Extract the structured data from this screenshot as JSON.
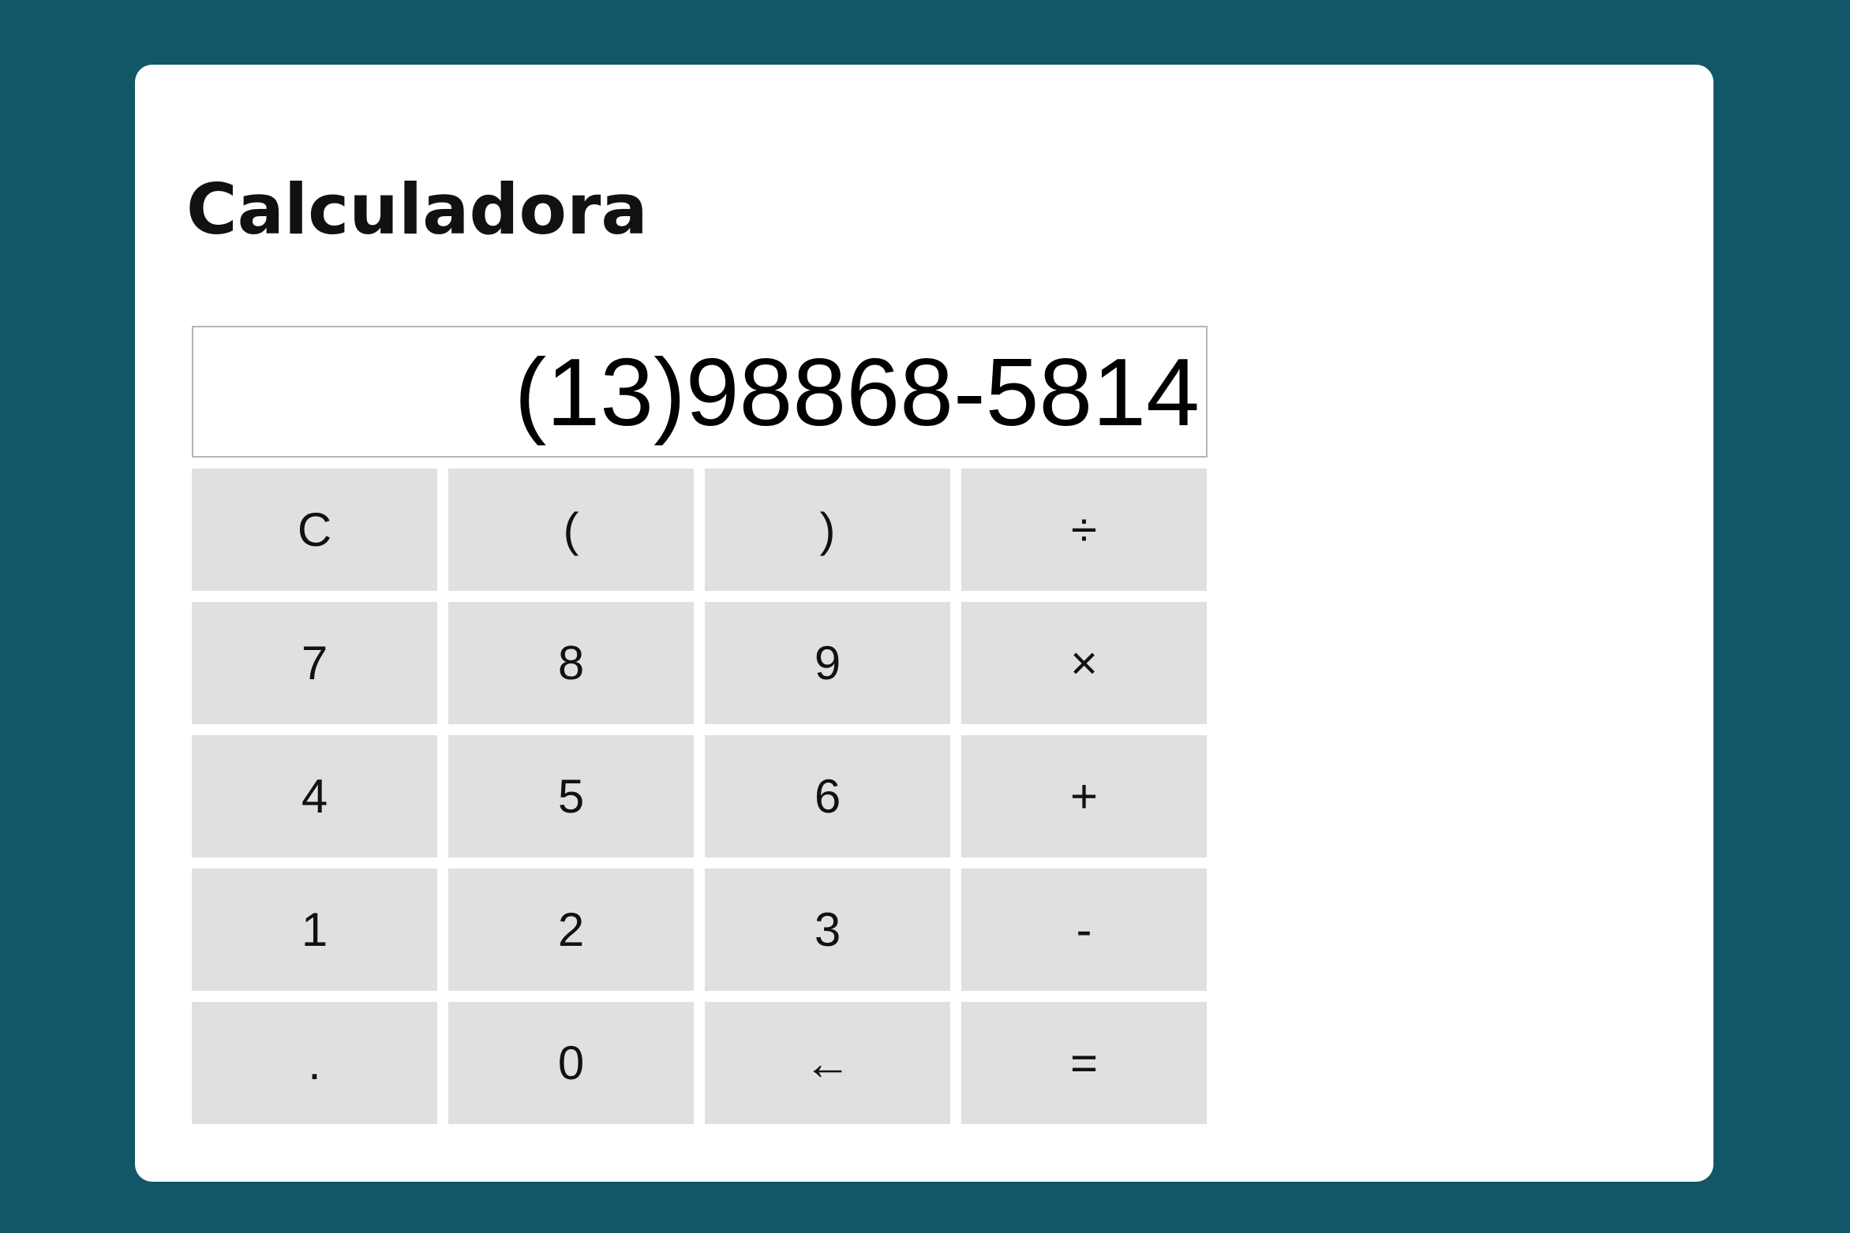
{
  "title": "Calculadora",
  "display": {
    "value": "(13)98868-5814"
  },
  "colors": {
    "background": "#125767",
    "card": "#ffffff",
    "key": "#e0e0e0"
  },
  "keys": [
    {
      "label": "C",
      "name": "key-clear"
    },
    {
      "label": "(",
      "name": "key-open-paren"
    },
    {
      "label": ")",
      "name": "key-close-paren"
    },
    {
      "label": "÷",
      "name": "key-divide"
    },
    {
      "label": "7",
      "name": "key-7"
    },
    {
      "label": "8",
      "name": "key-8"
    },
    {
      "label": "9",
      "name": "key-9"
    },
    {
      "label": "×",
      "name": "key-multiply"
    },
    {
      "label": "4",
      "name": "key-4"
    },
    {
      "label": "5",
      "name": "key-5"
    },
    {
      "label": "6",
      "name": "key-6"
    },
    {
      "label": "+",
      "name": "key-add"
    },
    {
      "label": "1",
      "name": "key-1"
    },
    {
      "label": "2",
      "name": "key-2"
    },
    {
      "label": "3",
      "name": "key-3"
    },
    {
      "label": "-",
      "name": "key-subtract"
    },
    {
      "label": ".",
      "name": "key-decimal"
    },
    {
      "label": "0",
      "name": "key-0"
    },
    {
      "label": "←",
      "name": "key-backspace"
    },
    {
      "label": "=",
      "name": "key-equals"
    }
  ]
}
